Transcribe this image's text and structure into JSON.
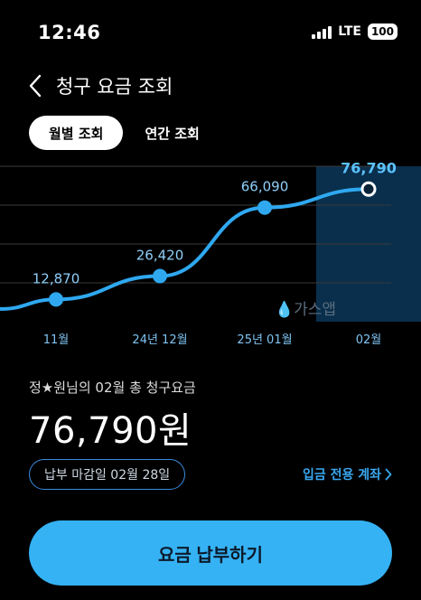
{
  "status_bar": {
    "time": "12:46",
    "network": "LTE",
    "battery": "100"
  },
  "header": {
    "title": "청구 요금 조회"
  },
  "tabs": [
    {
      "label": "월별 조회",
      "active": true
    },
    {
      "label": "연간 조회",
      "active": false
    }
  ],
  "chart_data": {
    "type": "line",
    "categories": [
      "11월",
      "24년 12월",
      "25년 01월",
      "02월"
    ],
    "values": [
      12870,
      26420,
      66090,
      76790
    ],
    "value_labels": [
      "12,870",
      "26,420",
      "66,090",
      "76,790"
    ],
    "watermark": "가스앱",
    "ylim": [
      0,
      90000
    ],
    "grid": true,
    "highlight_index": 3,
    "colors": {
      "line": "#2fa8f0",
      "highlight_band": "#0c3f66",
      "grid": "#3a3a3a"
    }
  },
  "bill": {
    "label": "정★원님의 02월 총 청구요금",
    "amount": "76,790원"
  },
  "due_date": "납부 마감일 02월 28일",
  "deposit_link": "입금 전용 계좌",
  "pay_button": "요금 납부하기",
  "colors": {
    "accent": "#35b2f4",
    "background": "#000000",
    "link": "#3aa8f0"
  }
}
